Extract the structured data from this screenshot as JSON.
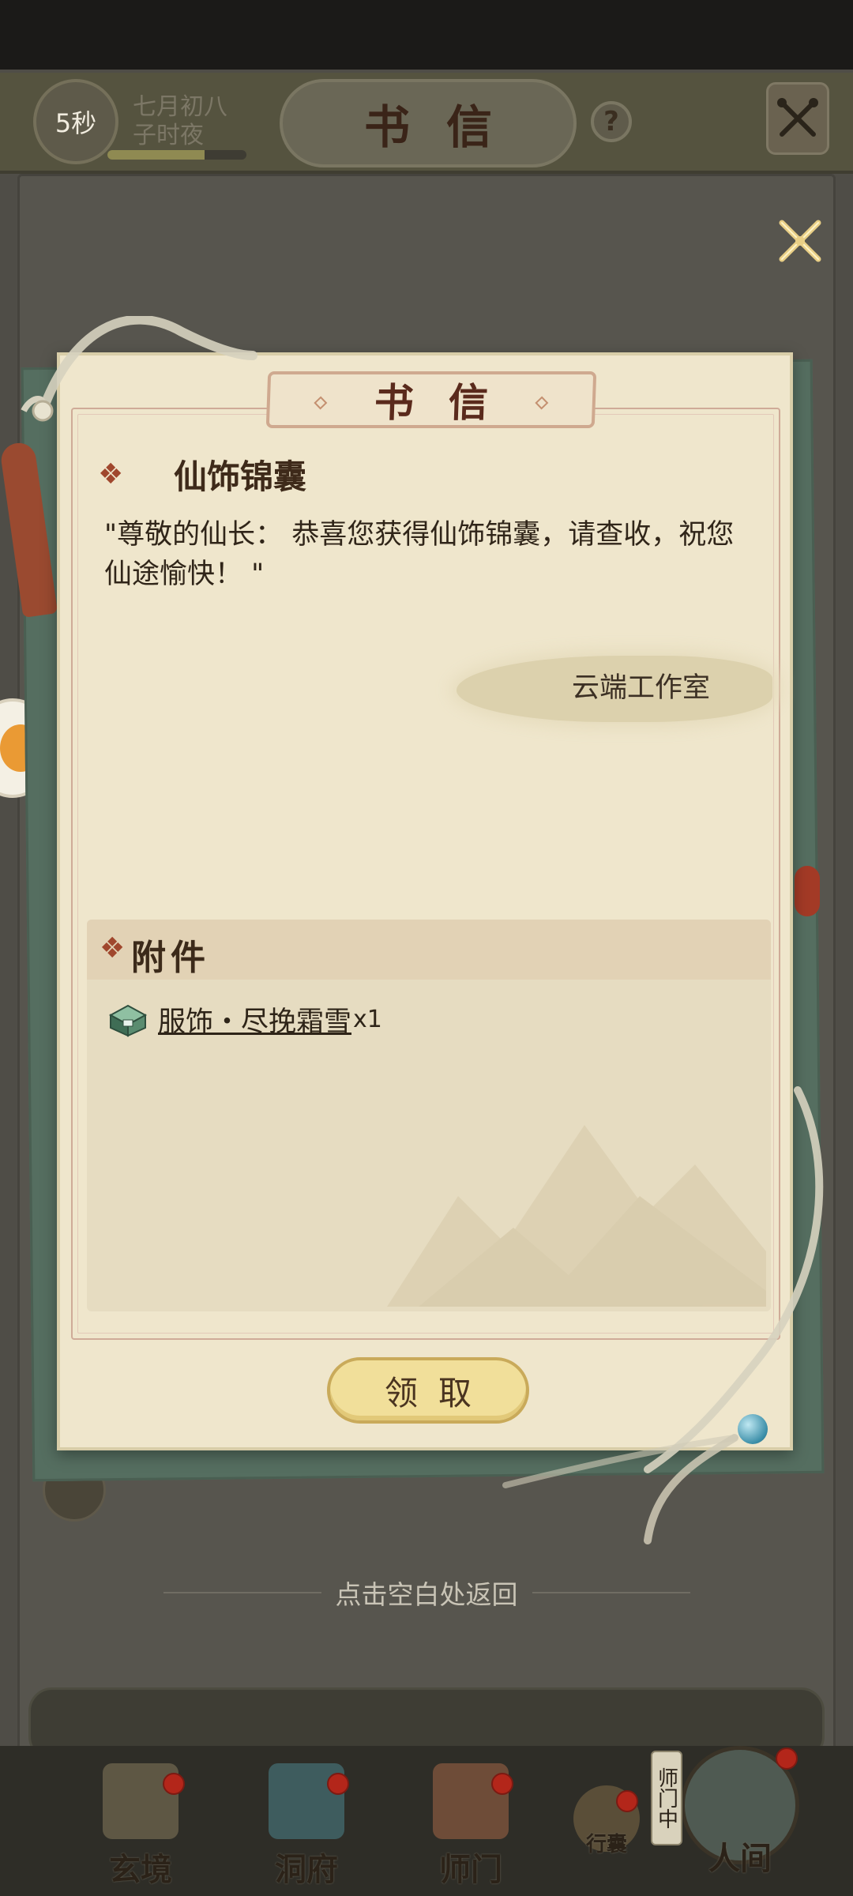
{
  "header": {
    "timer": "5秒",
    "date_line1": "七月初八",
    "date_line2": "子时夜",
    "time_progress": 0.7,
    "title": "书信",
    "help_glyph": "?",
    "tools_icon": "crossed-tools-icon"
  },
  "letter": {
    "title": "书信",
    "subject_marker": "❖",
    "subject": "仙饰锦囊",
    "body": "\"尊敬的仙长： 恭喜您获得仙饰锦囊，请查收，祝您仙途愉快！ \"",
    "sender": "云端工作室",
    "attachment": {
      "marker": "❖",
      "title": "附件",
      "item_name": "服饰・尽挽霜雪",
      "item_qty": "x1",
      "item_icon": "treasure-chest-icon"
    },
    "claim_label": "领取"
  },
  "hint": "点击空白处返回",
  "nav": {
    "items": [
      {
        "label": "玄境",
        "icon": "scroll-icon"
      },
      {
        "label": "洞府",
        "icon": "pavilion-icon"
      },
      {
        "label": "师门",
        "icon": "banner-icon"
      },
      {
        "label": "行囊",
        "icon": "pouch-icon"
      },
      {
        "label": "人间",
        "icon": "mountain-icon"
      }
    ],
    "side_tag": "师门中"
  },
  "colors": {
    "accent": "#a0472d",
    "paper": "#efe6cc",
    "claim": "#f1df9a"
  }
}
